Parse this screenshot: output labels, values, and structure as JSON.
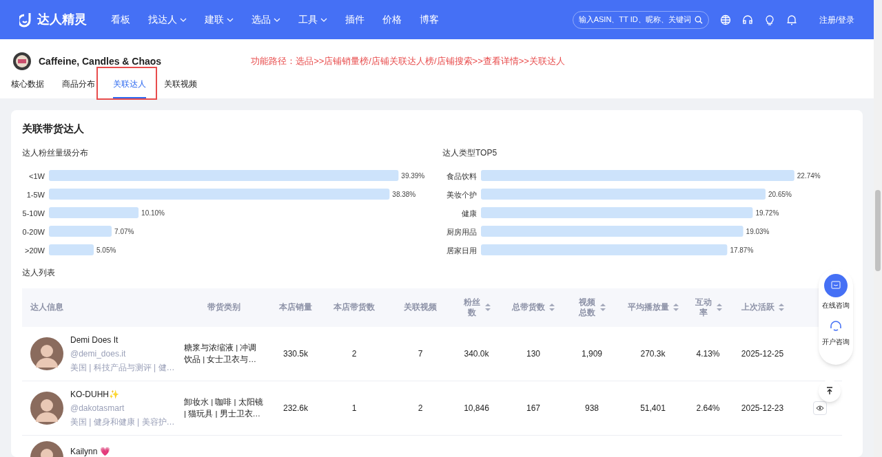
{
  "nav": {
    "logo": "达人精灵",
    "items": [
      {
        "label": "看板",
        "dropdown": false
      },
      {
        "label": "找达人",
        "dropdown": true
      },
      {
        "label": "建联",
        "dropdown": true
      },
      {
        "label": "选品",
        "dropdown": true
      },
      {
        "label": "工具",
        "dropdown": true
      },
      {
        "label": "插件",
        "dropdown": false
      },
      {
        "label": "价格",
        "dropdown": false
      },
      {
        "label": "博客",
        "dropdown": false
      }
    ],
    "search": {
      "placeholder": "输入ASIN、TT ID、昵称、关键词"
    },
    "login": "注册/登录"
  },
  "store": {
    "name": "Caffeine, Candles & Chaos",
    "path_note": "功能路径：选品>>店铺销量榜/店铺关联达人榜/店铺搜索>>查看详情>>关联达人"
  },
  "tabs": [
    {
      "label": "核心数据",
      "selected": false,
      "annotated": false
    },
    {
      "label": "商品分布",
      "selected": false,
      "annotated": false
    },
    {
      "label": "关联达人",
      "selected": true,
      "annotated": true
    },
    {
      "label": "关联视频",
      "selected": false,
      "annotated": false
    }
  ],
  "section_title": "关联带货达人",
  "fan_chart": {
    "chart_data": {
      "type": "bar",
      "orientation": "horizontal",
      "title": "达人粉丝量级分布",
      "categories": [
        "<1W",
        "1-5W",
        "5-10W",
        "0-20W",
        ">20W"
      ],
      "values": [
        39.39,
        38.38,
        10.1,
        7.07,
        5.05
      ],
      "value_labels": [
        "39.39%",
        "38.38%",
        "10.10%",
        "7.07%",
        "5.05%"
      ]
    }
  },
  "type_chart": {
    "chart_data": {
      "type": "bar",
      "orientation": "horizontal",
      "title": "达人类型TOP5",
      "categories": [
        "食品饮料",
        "美妆个护",
        "健康",
        "厨房用品",
        "居家日用"
      ],
      "values": [
        22.74,
        20.65,
        19.72,
        19.03,
        17.87
      ],
      "value_labels": [
        "22.74%",
        "20.65%",
        "19.72%",
        "19.03%",
        "17.87%"
      ]
    }
  },
  "list_title": "达人列表",
  "table": {
    "columns": [
      {
        "label": "达人信息",
        "sortable": false
      },
      {
        "label": "带货类别",
        "sortable": false
      },
      {
        "label": "本店销量",
        "sortable": false
      },
      {
        "label": "本店带货数",
        "sortable": false
      },
      {
        "label": "关联视频",
        "sortable": false
      },
      {
        "label": "粉丝数",
        "sortable": true
      },
      {
        "label": "总带货数",
        "sortable": true
      },
      {
        "label": "视频总数",
        "sortable": true
      },
      {
        "label": "平均播放量",
        "sortable": true
      },
      {
        "label": "互动率",
        "sortable": true
      },
      {
        "label": "上次活跃",
        "sortable": true
      }
    ],
    "rows": [
      {
        "name": "Demi Does It",
        "handle": "@demi_does.it",
        "tags": "美国 | 科技产品与测评 | 健…",
        "categories": "糖浆与浓缩液 | 冲调饮品 | 女士卫衣与…",
        "cells": [
          "330.5k",
          "2",
          "7",
          "340.0k",
          "130",
          "1,909",
          "270.3k",
          "4.13%",
          "2025-12-25"
        ],
        "action_visible": false
      },
      {
        "name": "KO-DUHH✨",
        "handle": "@dakotasmart",
        "tags": "美国 | 健身和健康 | 美容护…",
        "categories": "卸妆水 | 咖啡 | 太阳镜 | 猫玩具 | 男士卫衣…",
        "cells": [
          "232.6k",
          "1",
          "2",
          "10,846",
          "167",
          "938",
          "51,401",
          "2.64%",
          "2025-12-23"
        ],
        "action_visible": true
      },
      {
        "name": "Kailynn 💗"
      }
    ]
  },
  "float_panel": {
    "items": [
      "在线咨询",
      "开户咨询"
    ]
  }
}
